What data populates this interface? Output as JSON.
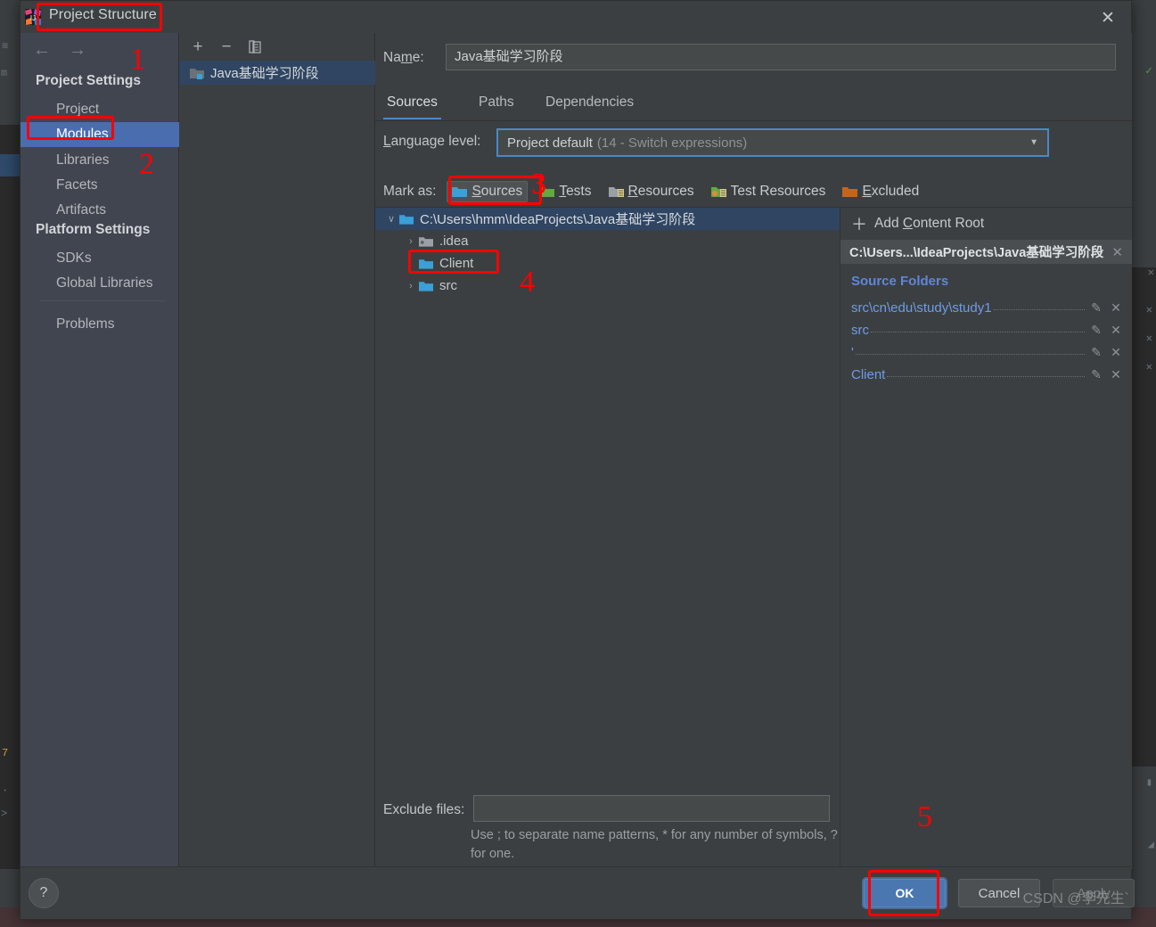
{
  "dialog": {
    "title": "Project Structure",
    "close_label": "✕",
    "app_icon": "intellij-idea-icon"
  },
  "sidebar": {
    "nav": {
      "back": "←",
      "forward": "→"
    },
    "sections": [
      {
        "header": "Project Settings",
        "items": [
          "Project",
          "Modules",
          "Libraries",
          "Facets",
          "Artifacts"
        ]
      },
      {
        "header": "Platform Settings",
        "items": [
          "SDKs",
          "Global Libraries"
        ]
      }
    ],
    "selected": "Modules",
    "footer_item": "Problems"
  },
  "modules_panel": {
    "toolbar": {
      "add": "+",
      "remove": "−",
      "copy": "copy-icon"
    },
    "items": [
      {
        "label": "Java基础学习阶段",
        "selected": true
      }
    ]
  },
  "module": {
    "name_label": "Name:",
    "name_value": "Java基础学习阶段",
    "tabs": [
      {
        "label": "Sources",
        "active": true
      },
      {
        "label": "Paths",
        "active": false
      },
      {
        "label": "Dependencies",
        "active": false
      }
    ],
    "language_level": {
      "label": "Language level:",
      "value": "Project default",
      "detail": "(14 - Switch expressions)",
      "arrow": "▼"
    },
    "mark_as": {
      "label": "Mark as:",
      "options": [
        {
          "label": "Sources",
          "color": "#4a9ac4",
          "pressed": true
        },
        {
          "label": "Tests",
          "color": "#6aa84f",
          "pressed": false
        },
        {
          "label": "Resources",
          "color": "#9aa0a6",
          "pressed": false
        },
        {
          "label": "Test Resources",
          "color": "#d98b36",
          "pressed": false
        },
        {
          "label": "Excluded",
          "color": "#c4651f",
          "pressed": false
        }
      ]
    },
    "tree": [
      {
        "label": "C:\\Users\\hmm\\IdeaProjects\\Java基础学习阶段",
        "depth": 0,
        "caret": "∨",
        "selected": true,
        "icon": "folder-blue-icon"
      },
      {
        "label": ".idea",
        "depth": 1,
        "caret": "›",
        "selected": false,
        "icon": "folder-idea-icon"
      },
      {
        "label": "Client",
        "depth": 1,
        "caret": "",
        "selected": false,
        "icon": "folder-source-icon"
      },
      {
        "label": "src",
        "depth": 1,
        "caret": "›",
        "selected": false,
        "icon": "folder-source-icon"
      }
    ],
    "content_roots": {
      "add_label": "Add Content Root",
      "add_icon": "plus-icon",
      "root_path": "C:\\Users...\\IdeaProjects\\Java基础学习阶段",
      "root_remove": "✕",
      "source_folders_title": "Source Folders",
      "source_folders": [
        {
          "name": "src\\cn\\edu\\study\\study1"
        },
        {
          "name": "src"
        },
        {
          "name": "'"
        },
        {
          "name": "Client"
        }
      ],
      "edit_icon": "✎",
      "delete_icon": "✕"
    },
    "exclude": {
      "label": "Exclude files:",
      "value": "",
      "hint": "Use ; to separate name patterns, * for any number of symbols, ? for one."
    }
  },
  "buttons": {
    "help": "?",
    "ok": "OK",
    "cancel": "Cancel",
    "apply": "Apply"
  },
  "annotations": {
    "numbers": [
      "1",
      "2",
      "3",
      "4",
      "5"
    ]
  },
  "watermark": "CSDN @李先生`",
  "colors": {
    "accent_blue": "#4a88c7",
    "selection_blue": "#4a6daf",
    "tree_selection": "#2f4562",
    "link_blue": "#6d9ce8",
    "annotation_red": "#ff0000",
    "panel_bg": "#3c3f41",
    "sidebar_bg": "#414550"
  }
}
